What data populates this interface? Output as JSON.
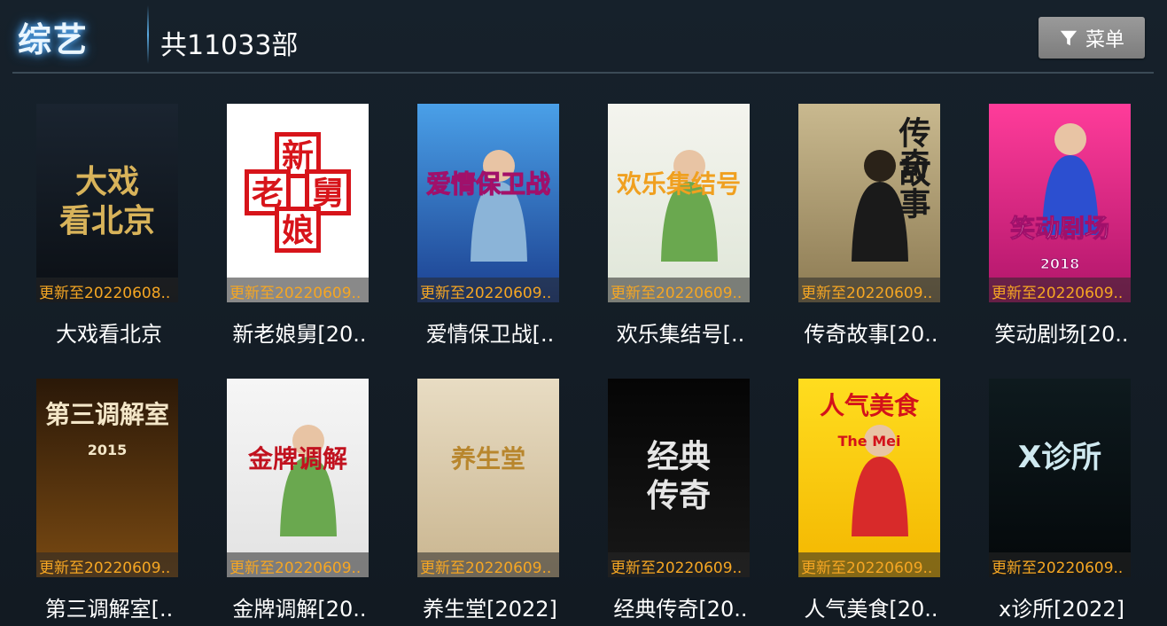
{
  "header": {
    "category": "综艺",
    "count": "共11033部",
    "menu_label": "菜单",
    "menu_icon": "filter-icon"
  },
  "items": [
    {
      "title": "大戏看北京",
      "update": "更新至20220608.."
    },
    {
      "title": "新老娘舅[20..",
      "update": "更新至20220609.."
    },
    {
      "title": "爱情保卫战[..",
      "update": "更新至20220609.."
    },
    {
      "title": "欢乐集结号[..",
      "update": "更新至20220609.."
    },
    {
      "title": "传奇故事[20..",
      "update": "更新至20220609.."
    },
    {
      "title": "笑动剧场[20..",
      "update": "更新至20220609.."
    },
    {
      "title": "第三调解室[..",
      "update": "更新至20220609.."
    },
    {
      "title": "金牌调解[20..",
      "update": "更新至20220609.."
    },
    {
      "title": "养生堂[2022]",
      "update": "更新至20220609.."
    },
    {
      "title": "经典传奇[20..",
      "update": "更新至20220609.."
    },
    {
      "title": "人气美食[20..",
      "update": "更新至20220609.."
    },
    {
      "title": "x诊所[2022]",
      "update": "更新至20220609.."
    }
  ],
  "posters": [
    {
      "lines": [
        "大戏",
        "看北京"
      ],
      "bg1": "#1a2430",
      "bg2": "#0b0f14",
      "fg": "#d8b35a"
    },
    {
      "lines": [
        "新",
        "老",
        "舅",
        "娘"
      ],
      "bg1": "#ffffff",
      "bg2": "#ffffff",
      "fg": "#d7141a"
    },
    {
      "lines": [
        "爱情保卫战"
      ],
      "bg1": "#4aa0e8",
      "bg2": "#1b3f8f",
      "fg": "#e8242b"
    },
    {
      "lines": [
        "欢乐集结号"
      ],
      "bg1": "#f4f4ee",
      "bg2": "#dfe6d8",
      "fg": "#f0a020"
    },
    {
      "lines": [
        "传奇",
        "故事"
      ],
      "bg1": "#c9b98f",
      "bg2": "#8c7a52",
      "fg": "#1a1a1a"
    },
    {
      "lines": [
        "笑动剧场",
        "2018"
      ],
      "bg1": "#ff3c9a",
      "bg2": "#b0156a",
      "fg": "#ffffff"
    },
    {
      "lines": [
        "第三调解室",
        "2015"
      ],
      "bg1": "#2a1808",
      "bg2": "#7a4a12",
      "fg": "#f3e6c8"
    },
    {
      "lines": [
        "金牌调解"
      ],
      "bg1": "#f6f6f6",
      "bg2": "#e2e2e2",
      "fg": "#c1121f"
    },
    {
      "lines": [
        "养生堂"
      ],
      "bg1": "#e8dcc3",
      "bg2": "#c9b58f",
      "fg": "#b8862d"
    },
    {
      "lines": [
        "经典",
        "传奇"
      ],
      "bg1": "#050505",
      "bg2": "#181818",
      "fg": "#e6e6e6"
    },
    {
      "lines": [
        "人气美食",
        "The Mei"
      ],
      "bg1": "#ffdd1f",
      "bg2": "#f3b600",
      "fg": "#d3121a"
    },
    {
      "lines": [
        "X诊所"
      ],
      "bg1": "#0e1a1e",
      "bg2": "#04080a",
      "fg": "#cfe9f0"
    }
  ]
}
